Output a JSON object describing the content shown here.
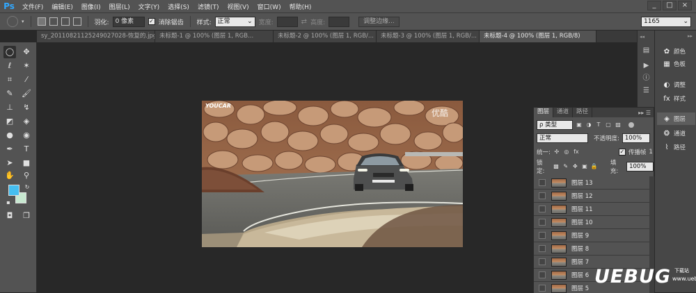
{
  "app": {
    "logo": "Ps"
  },
  "menu": [
    "文件(F)",
    "编辑(E)",
    "图像(I)",
    "图层(L)",
    "文字(Y)",
    "选择(S)",
    "滤镜(T)",
    "视图(V)",
    "窗口(W)",
    "帮助(H)"
  ],
  "window_controls": [
    "_",
    "□",
    "×"
  ],
  "options": {
    "feather_label": "羽化:",
    "feather_value": "0 像素",
    "antialias_label": "消除锯齿",
    "style_label": "样式:",
    "style_value": "正常",
    "width_label": "宽度:",
    "height_label": "高度:",
    "refine_edge_label": "调整边缘...",
    "workspace_value": "1165"
  },
  "tabs": [
    {
      "label": "sy_20110821125249027028-恢复的.jpg @ 66....",
      "active": false
    },
    {
      "label": "未标题-1 @ 100% (图层 1, RGB...",
      "active": false
    },
    {
      "label": "未标题-2 @ 100% (图层 1, RGB/...",
      "active": false
    },
    {
      "label": "未标题-3 @ 100% (图层 1, RGB/...",
      "active": false
    },
    {
      "label": "未标题-4 @ 100% (图层 1, RGB/8)",
      "active": true
    }
  ],
  "canvas": {
    "logo_text": "YOUCAR",
    "corner_text": "优酷"
  },
  "dock": {
    "items": [
      {
        "label": "颜色",
        "icon": "palette-icon"
      },
      {
        "label": "色板",
        "icon": "swatches-icon"
      },
      {
        "label": "调整",
        "icon": "adjustments-icon"
      },
      {
        "label": "样式",
        "icon": "styles-icon"
      },
      {
        "label": "图层",
        "icon": "layers-icon",
        "active": true
      },
      {
        "label": "通道",
        "icon": "channels-icon"
      },
      {
        "label": "路径",
        "icon": "paths-icon"
      }
    ]
  },
  "layers_panel": {
    "tabs": [
      "图层",
      "通道",
      "路径"
    ],
    "filter_label": "ρ 类型",
    "blend_mode": "正常",
    "opacity_label": "不透明度:",
    "opacity_value": "100%",
    "unify_label": "统一:",
    "propagate_label": "传播帧",
    "propagate_value": "1",
    "lock_label": "锁定:",
    "fill_label": "填充:",
    "fill_value": "100%",
    "layers": [
      "图层 13",
      "图层 12",
      "图层 11",
      "图层 10",
      "图层 9",
      "图层 8",
      "图层 7",
      "图层 6",
      "图层 5"
    ]
  },
  "watermark": {
    "text": "UEBUG",
    "small": "下载站",
    "url": "www.uebug.com"
  },
  "colors": {
    "foreground": "#45bef0",
    "background": "#c7e8d0",
    "accent": "#31a8ff"
  }
}
